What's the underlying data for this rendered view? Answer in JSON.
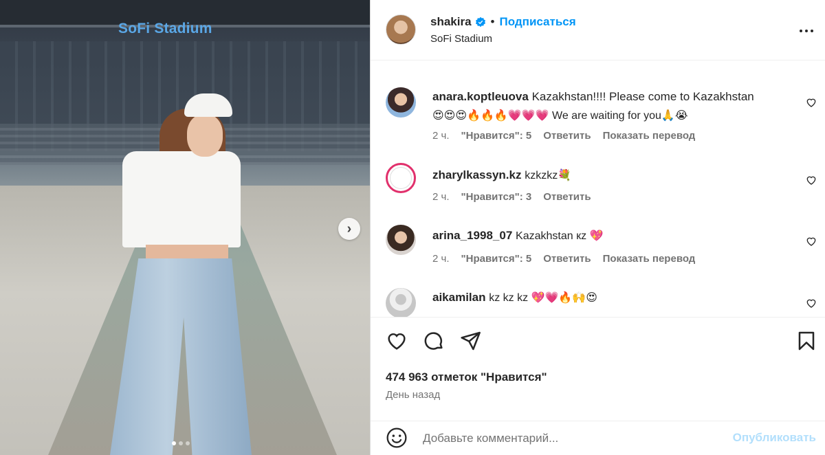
{
  "post": {
    "author": "shakira",
    "follow_label": "Подписаться",
    "location": "SoFi Stadium",
    "likes_text": "474 963 отметок \"Нравится\"",
    "date_text": "День назад",
    "carousel": {
      "current": 1,
      "total": 3
    },
    "photo_sign": "SoFi Stadium"
  },
  "comments": [
    {
      "user": "anara.koptleuova",
      "text_line1": "Kazakhstan!!!! Please come to Kazakhstan",
      "text_line2": "😍😍😍🔥🔥🔥💗💗💗 We are waiting for you🙏😭",
      "time": "2 ч.",
      "likes": "\"Нравится\": 5",
      "reply": "Ответить",
      "translate": "Показать перевод"
    },
    {
      "user": "zharylkassyn.kz",
      "text_line1": "kzkzkz💐",
      "time": "2 ч.",
      "likes": "\"Нравится\": 3",
      "reply": "Ответить"
    },
    {
      "user": "arina_1998_07",
      "text_line1": "Kazakhstan кz 💖",
      "time": "2 ч.",
      "likes": "\"Нравится\": 5",
      "reply": "Ответить",
      "translate": "Показать перевод"
    },
    {
      "user": "aikamilan",
      "text_line1": "kz kz kz 💖💗🔥🙌😍"
    }
  ],
  "comment_box": {
    "placeholder": "Добавьте комментарий...",
    "publish_label": "Опубликовать"
  },
  "colors": {
    "accent": "#0095f6",
    "publish_disabled": "#b2dffc",
    "muted": "#737373"
  }
}
